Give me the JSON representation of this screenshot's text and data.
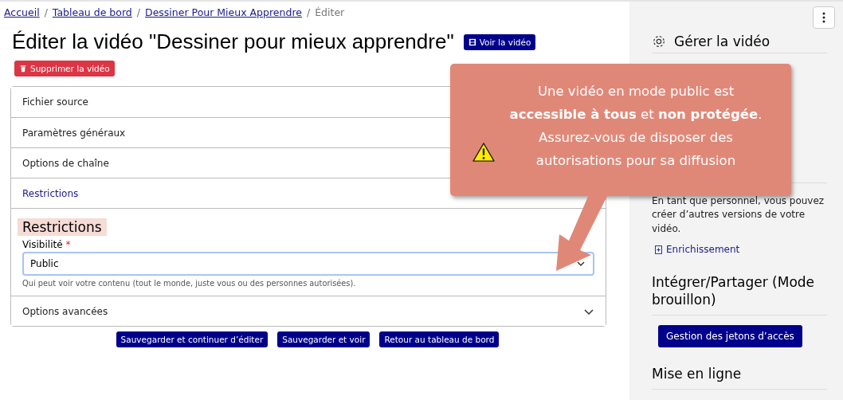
{
  "breadcrumb": [
    {
      "label": "Accueil",
      "link": true
    },
    {
      "separator": "/",
      "label": "Tableau de bord",
      "link": true
    },
    {
      "separator": "/",
      "label": "Dessiner Pour Mieux Apprendre",
      "link": true
    },
    {
      "separator": "/",
      "label": "Éditer",
      "link": false
    }
  ],
  "title": "Éditer la vidéo \"Dessiner pour mieux apprendre\"",
  "view_button": "Voir la vidéo",
  "delete_button": "Supprimer la vidéo",
  "accordion": [
    {
      "label": "Fichier source",
      "expanded": false
    },
    {
      "label": "Paramètres généraux",
      "expanded": false
    },
    {
      "label": "Options de chaîne",
      "expanded": false
    },
    {
      "label": "Restrictions",
      "expanded": true,
      "panel": {
        "heading": "Restrictions",
        "field_label": "Visibilité",
        "required": true,
        "required_mark": "*",
        "value": "Public",
        "help": "Qui peut voir votre contenu (tout le monde, juste vous ou des personnes autorisées)."
      }
    },
    {
      "label": "Options avancées",
      "expanded": false
    }
  ],
  "form_buttons": [
    "Sauvegarder et continuer d’éditer",
    "Sauvegarder et voir",
    "Retour au tableau de bord"
  ],
  "sidebar": {
    "heading": "Gérer la vidéo",
    "versions_text": "En tant que personnel, vous pouvez créer d’autres versions de votre vidéo.",
    "enrich_link": "Enrichissement",
    "share_heading": "Intégrer/Partager (Mode brouillon)",
    "tokens_button": "Gestion des jetons d’accès",
    "upload_heading": "Mise en ligne"
  },
  "callout": {
    "text": "Une vidéo en mode public est **accessible à tous** et **non protégée**. Assurez-vous de disposer des autorisations pour sa diffusion"
  }
}
